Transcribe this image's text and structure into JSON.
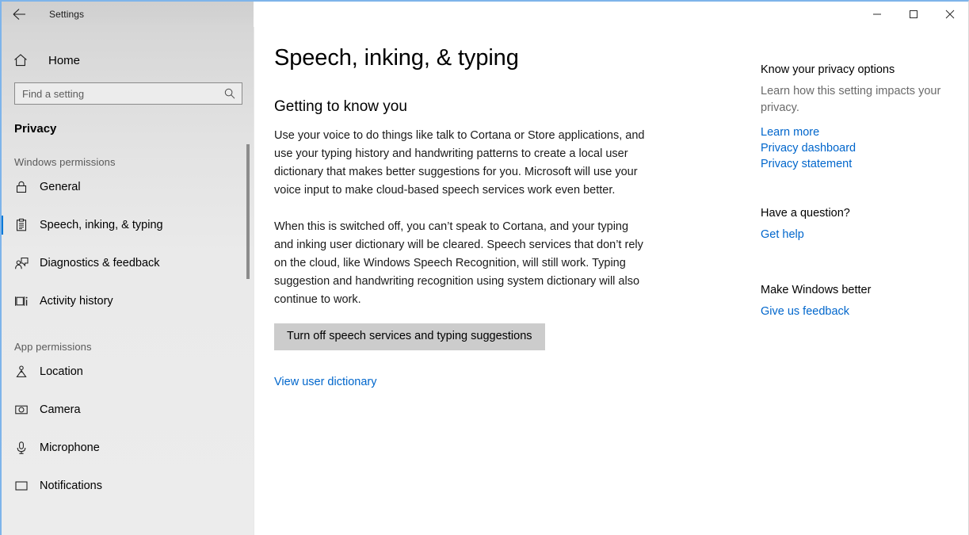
{
  "window": {
    "title": "Settings",
    "back_icon": "back-arrow-icon",
    "minimize_label": "─",
    "maximize_label": "□",
    "close_label": "✕",
    "accent_color": "#0078d7",
    "link_color": "#0066cc"
  },
  "sidebar": {
    "home_label": "Home",
    "home_icon": "home-icon",
    "search": {
      "placeholder": "Find a setting",
      "value": "",
      "icon": "search-icon"
    },
    "category": "Privacy",
    "groups": [
      {
        "title": "Windows permissions",
        "items": [
          {
            "label": "General",
            "icon": "lock-icon",
            "selected": false
          },
          {
            "label": "Speech, inking, & typing",
            "icon": "clipboard-icon",
            "selected": true
          },
          {
            "label": "Diagnostics & feedback",
            "icon": "person-feedback-icon",
            "selected": false
          },
          {
            "label": "Activity history",
            "icon": "activity-history-icon",
            "selected": false
          }
        ]
      },
      {
        "title": "App permissions",
        "items": [
          {
            "label": "Location",
            "icon": "location-pin-icon",
            "selected": false
          },
          {
            "label": "Camera",
            "icon": "camera-icon",
            "selected": false
          },
          {
            "label": "Microphone",
            "icon": "microphone-icon",
            "selected": false
          },
          {
            "label": "Notifications",
            "icon": "notifications-icon",
            "selected": false
          }
        ]
      }
    ]
  },
  "main": {
    "page_title": "Speech, inking, & typing",
    "section_heading": "Getting to know you",
    "paragraph_1": "Use your voice to do things like talk to Cortana or Store applications, and use your typing history and handwriting patterns to create a local user dictionary that makes better suggestions for you. Microsoft will use your voice input to make cloud-based speech services work even better.",
    "paragraph_2": "When this is switched off, you can’t speak to Cortana, and your typing and inking user dictionary will be cleared. Speech services that don’t rely on the cloud, like Windows Speech Recognition, will still work. Typing suggestion and handwriting recognition using system dictionary will also continue to work.",
    "toggle_button_label": "Turn off speech services and typing suggestions",
    "dictionary_link": "View user dictionary"
  },
  "rail": {
    "privacy": {
      "heading": "Know your privacy options",
      "subtext": "Learn how this setting impacts your privacy.",
      "links": [
        "Learn more",
        "Privacy dashboard",
        "Privacy statement"
      ]
    },
    "question": {
      "heading": "Have a question?",
      "links": [
        "Get help"
      ]
    },
    "feedback": {
      "heading": "Make Windows better",
      "links": [
        "Give us feedback"
      ]
    }
  }
}
